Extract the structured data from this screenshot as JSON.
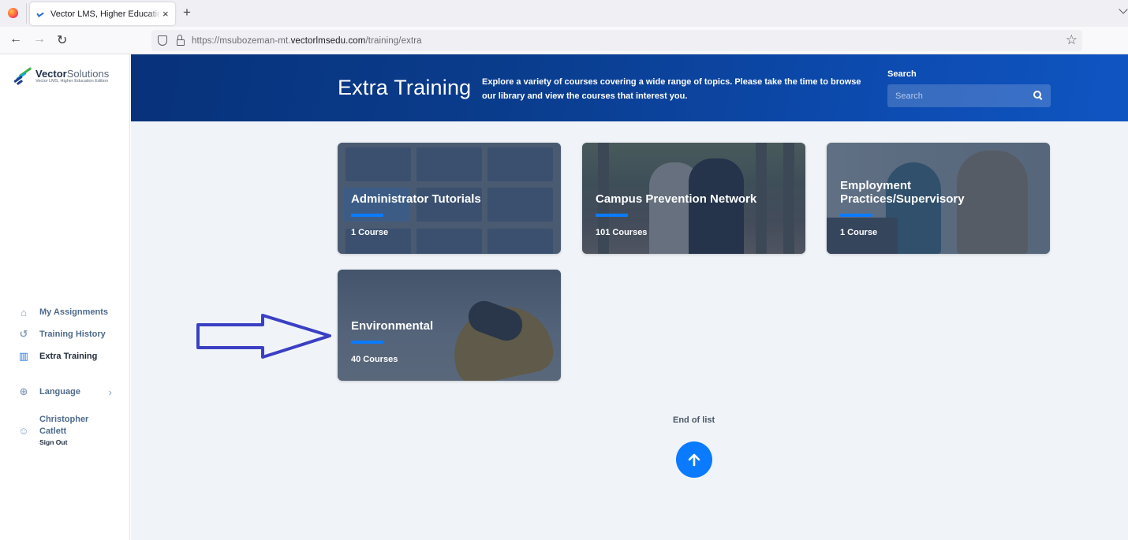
{
  "browser": {
    "tab_title": "Vector LMS, Higher Education Edition",
    "tab_close": "×",
    "new_tab": "+",
    "url_prefix": "https://msubozeman-mt.",
    "url_domain": "vectorlmsedu.com",
    "url_path": "/training/extra",
    "back": "←",
    "forward": "→",
    "reload": "↻",
    "star": "☆"
  },
  "sidebar": {
    "logo_brand_bold": "Vector",
    "logo_brand_light": "Solutions",
    "logo_sub": "Vector LMS, Higher Education Edition",
    "items": [
      {
        "label": "My Assignments",
        "icon": "home-icon",
        "glyph": "⌂",
        "active": false
      },
      {
        "label": "Training History",
        "icon": "history-icon",
        "glyph": "↺",
        "active": false
      },
      {
        "label": "Extra Training",
        "icon": "library-icon",
        "glyph": "▥",
        "active": true
      }
    ],
    "language": {
      "label": "Language",
      "icon": "globe-icon",
      "glyph": "⊕",
      "chevron": "›"
    },
    "user": {
      "name": "Christopher Catlett",
      "sign_out": "Sign Out",
      "icon": "user-icon",
      "glyph": "☺"
    }
  },
  "hero": {
    "title": "Extra Training",
    "description": "Explore a variety of courses covering a wide range of topics. Please take the time to browse our library and view the courses that interest you.",
    "search_label": "Search",
    "search_placeholder": "Search",
    "search_value": ""
  },
  "categories": [
    {
      "title": "Administrator Tutorials",
      "count": "1 Course"
    },
    {
      "title": "Campus Prevention Network",
      "count": "101 Courses"
    },
    {
      "title": "Employment Practices/Supervisory",
      "count": "1 Course"
    },
    {
      "title": "Environmental",
      "count": "40 Courses"
    }
  ],
  "footer": {
    "end_of_list": "End of list"
  },
  "colors": {
    "accent": "#0a7bff",
    "hero_start": "#08327a",
    "hero_end": "#0f55c2",
    "annotation_arrow": "#3a3fc4"
  }
}
